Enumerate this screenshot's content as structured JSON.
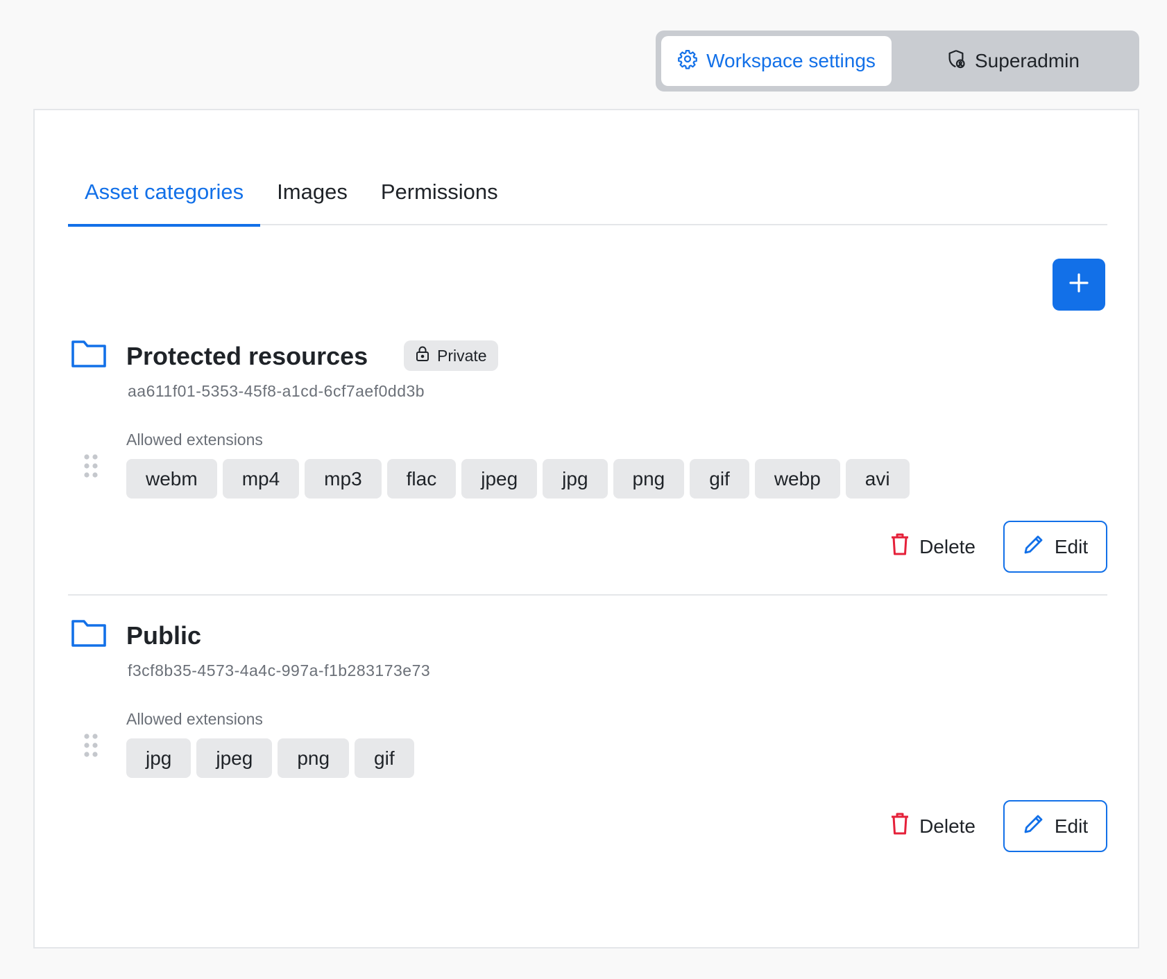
{
  "top_switch": {
    "workspace_label": "Workspace settings",
    "superadmin_label": "Superadmin"
  },
  "tabs": [
    {
      "label": "Asset categories",
      "active": true
    },
    {
      "label": "Images",
      "active": false
    },
    {
      "label": "Permissions",
      "active": false
    }
  ],
  "categories": [
    {
      "title": "Protected resources",
      "badge": "Private",
      "id": "aa611f01-5353-45f8-a1cd-6cf7aef0dd3b",
      "extensions_label": "Allowed extensions",
      "extensions": [
        "webm",
        "mp4",
        "mp3",
        "flac",
        "jpeg",
        "jpg",
        "png",
        "gif",
        "webp",
        "avi"
      ],
      "delete_label": "Delete",
      "edit_label": "Edit"
    },
    {
      "title": "Public",
      "id": "f3cf8b35-4573-4a4c-997a-f1b283173e73",
      "extensions_label": "Allowed extensions",
      "extensions": [
        "jpg",
        "jpeg",
        "png",
        "gif"
      ],
      "delete_label": "Delete",
      "edit_label": "Edit"
    }
  ],
  "icons": {
    "workspace": "gear-icon",
    "superadmin": "shield-user-icon",
    "add": "plus-icon",
    "folder": "folder-icon",
    "lock": "lock-icon",
    "drag": "drag-handle-icon",
    "delete": "trash-icon",
    "edit": "pencil-icon"
  },
  "colors": {
    "accent": "#1270e8",
    "danger": "#e5213a",
    "chip_bg": "#e7e8ea",
    "muted_text": "#6b7078"
  }
}
